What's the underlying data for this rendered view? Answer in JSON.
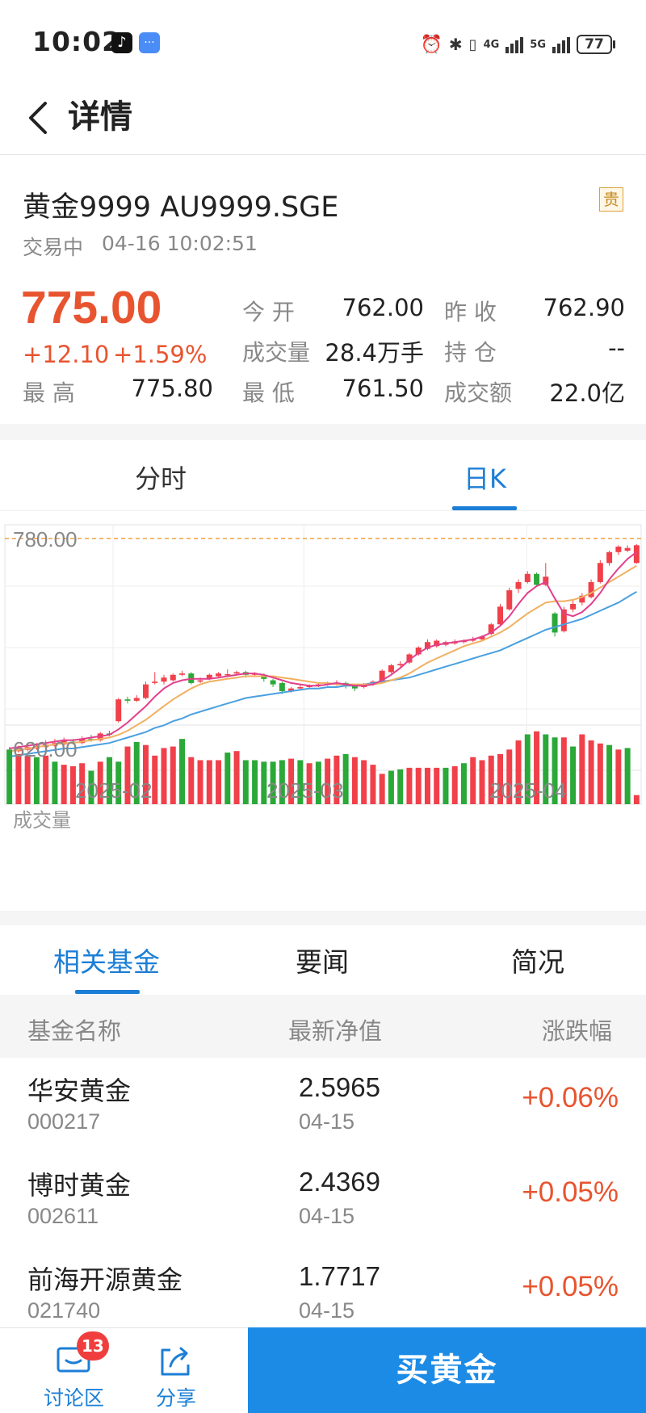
{
  "status_bar": {
    "time": "10:02",
    "network_4g": "4G",
    "network_5g": "5G",
    "battery": "77"
  },
  "nav": {
    "title": "详情"
  },
  "quote": {
    "name": "黄金9999 AU9999.SGE",
    "badge": "贵",
    "status": "交易中",
    "timestamp": "04-16 10:02:51",
    "price": "775.00",
    "change_abs": "+12.10",
    "change_pct": "+1.59%",
    "fields": {
      "open_label": "今  开",
      "open_value": "762.00",
      "prev_close_label": "昨  收",
      "prev_close_value": "762.90",
      "volume_label": "成交量",
      "volume_value": "28.4万手",
      "position_label": "持  仓",
      "position_value": "--",
      "high_label": "最  高",
      "high_value": "775.80",
      "low_label": "最  低",
      "low_value": "761.50",
      "turnover_label": "成交额",
      "turnover_value": "22.0亿"
    }
  },
  "chart_tabs": [
    "分时",
    "日K"
  ],
  "chart_data": {
    "type": "candlestick",
    "title": "",
    "y_labels": [
      "780.00",
      "620.00"
    ],
    "x_labels": [
      "2025-02",
      "2025-03",
      "2025-04"
    ],
    "volume_label": "成交量",
    "ylim": [
      610,
      790
    ],
    "ref_line": 780,
    "colors": {
      "up": "#f0404a",
      "down": "#2aa838",
      "ma5": "#e23f8c",
      "ma10": "#f0b060",
      "ma20": "#4aa0e0",
      "ref": "#f0a040"
    },
    "candles": [
      [
        623.0,
        625.0,
        627.0,
        622.0
      ],
      [
        624.0,
        626.0,
        628.0,
        623.0
      ],
      [
        625.0,
        627.0,
        629.0,
        624.0
      ],
      [
        626.0,
        628.0,
        630.0,
        625.0
      ],
      [
        627.0,
        629.0,
        632.0,
        626.0
      ],
      [
        628.0,
        630.0,
        633.0,
        627.0
      ],
      [
        629.0,
        632.0,
        634.0,
        628.0
      ],
      [
        631.0,
        630.0,
        633.0,
        629.0
      ],
      [
        630.0,
        633.0,
        635.0,
        629.0
      ],
      [
        633.0,
        632.0,
        636.0,
        631.0
      ],
      [
        632.0,
        637.0,
        638.0,
        631.0
      ],
      [
        637.0,
        636.0,
        639.0,
        635.0
      ],
      [
        646.0,
        662.0,
        663.0,
        645.0
      ],
      [
        662.0,
        661.0,
        664.0,
        659.0
      ],
      [
        661.0,
        663.0,
        665.0,
        660.0
      ],
      [
        663.0,
        673.0,
        675.0,
        662.0
      ],
      [
        674.0,
        675.0,
        682.0,
        673.0
      ],
      [
        675.0,
        678.0,
        680.0,
        673.0
      ],
      [
        676.0,
        680.0,
        681.0,
        675.0
      ],
      [
        680.0,
        681.0,
        683.0,
        679.0
      ],
      [
        681.0,
        674.0,
        682.0,
        673.0
      ],
      [
        675.0,
        676.0,
        678.0,
        674.0
      ],
      [
        677.0,
        680.0,
        681.0,
        676.0
      ],
      [
        679.0,
        681.0,
        682.0,
        678.0
      ],
      [
        680.0,
        680.5,
        684.0,
        679.0
      ],
      [
        681.0,
        682.0,
        683.0,
        680.0
      ],
      [
        682.0,
        680.0,
        683.0,
        678.0
      ],
      [
        680.0,
        681.0,
        682.0,
        679.0
      ],
      [
        680.0,
        677.0,
        681.0,
        675.0
      ],
      [
        676.0,
        673.0,
        677.0,
        671.0
      ],
      [
        674.0,
        668.0,
        675.0,
        666.0
      ],
      [
        668.0,
        670.0,
        671.0,
        667.0
      ],
      [
        670.0,
        671.0,
        673.0,
        669.0
      ],
      [
        671.0,
        672.0,
        673.0,
        670.0
      ],
      [
        672.0,
        673.0,
        674.0,
        671.0
      ],
      [
        673.0,
        673.5,
        675.0,
        672.0
      ],
      [
        673.0,
        674.0,
        676.0,
        672.0
      ],
      [
        674.0,
        672.0,
        675.0,
        670.0
      ],
      [
        672.0,
        670.0,
        673.0,
        668.0
      ],
      [
        671.0,
        673.0,
        674.0,
        670.0
      ],
      [
        673.0,
        675.0,
        676.0,
        672.0
      ],
      [
        675.0,
        683.0,
        684.0,
        674.0
      ],
      [
        682.0,
        687.0,
        688.0,
        681.0
      ],
      [
        687.0,
        688.0,
        690.0,
        686.0
      ],
      [
        689.0,
        695.0,
        696.0,
        688.0
      ],
      [
        695.0,
        700.0,
        701.0,
        694.0
      ],
      [
        699.0,
        704.0,
        706.0,
        698.0
      ],
      [
        701.0,
        705.0,
        706.0,
        700.0
      ],
      [
        702.0,
        704.0,
        705.0,
        701.0
      ],
      [
        703.0,
        704.5,
        706.0,
        702.0
      ],
      [
        704.0,
        705.0,
        706.0,
        703.0
      ],
      [
        705.0,
        706.0,
        708.0,
        704.0
      ],
      [
        706.0,
        708.0,
        709.0,
        705.0
      ],
      [
        710.0,
        717.0,
        718.0,
        709.0
      ],
      [
        717.0,
        730.0,
        732.0,
        716.0
      ],
      [
        728.0,
        742.0,
        744.0,
        727.0
      ],
      [
        743.0,
        748.0,
        750.0,
        740.0
      ],
      [
        748.0,
        754.0,
        756.0,
        747.0
      ],
      [
        754.0,
        746.0,
        755.0,
        745.0
      ],
      [
        746.0,
        752.0,
        762.0,
        745.0
      ],
      [
        725.0,
        711.0,
        726.0,
        708.0
      ],
      [
        712.0,
        728.0,
        730.0,
        711.0
      ],
      [
        728.0,
        732.0,
        735.0,
        726.0
      ],
      [
        733.0,
        738.0,
        740.0,
        731.0
      ],
      [
        737.0,
        748.0,
        750.0,
        736.0
      ],
      [
        748.0,
        762.0,
        764.0,
        747.0
      ],
      [
        762.0,
        770.0,
        771.0,
        760.0
      ],
      [
        770.0,
        774.0,
        775.0,
        768.0
      ],
      [
        771.0,
        773.0,
        775.0,
        770.0
      ],
      [
        762.0,
        775.0,
        775.8,
        761.5
      ]
    ],
    "ma5": [
      626,
      627,
      628,
      629,
      630,
      631,
      632,
      632,
      633,
      634,
      635,
      636,
      640,
      645,
      651,
      657,
      664,
      670,
      674,
      676,
      677,
      677,
      677,
      678,
      679,
      680,
      681,
      681,
      680,
      678,
      676,
      674,
      673,
      672,
      672,
      673,
      674,
      673,
      672,
      672,
      673,
      676,
      680,
      685,
      691,
      696,
      700,
      702,
      703,
      704,
      705,
      706,
      708,
      711,
      716,
      723,
      732,
      740,
      745,
      748,
      736,
      725,
      723,
      726,
      732,
      740,
      750,
      758,
      765,
      770
    ],
    "ma10": [
      624,
      625,
      626,
      627,
      628,
      629,
      630,
      630,
      631,
      632,
      633,
      634,
      636,
      639,
      643,
      647,
      652,
      657,
      662,
      666,
      670,
      673,
      675,
      676,
      677,
      678,
      679,
      679,
      679,
      679,
      678,
      677,
      676,
      675,
      674,
      674,
      673,
      673,
      673,
      673,
      673,
      674,
      676,
      678,
      681,
      685,
      689,
      692,
      695,
      698,
      701,
      703,
      705,
      708,
      711,
      715,
      720,
      725,
      729,
      733,
      734,
      734,
      735,
      737,
      740,
      744,
      748,
      752,
      756,
      760
    ],
    "ma20": [
      620,
      621,
      622,
      623,
      624,
      625,
      626,
      626,
      627,
      628,
      629,
      630,
      632,
      634,
      636,
      638,
      641,
      643,
      646,
      648,
      651,
      653,
      655,
      657,
      659,
      661,
      663,
      664,
      665,
      666,
      667,
      668,
      669,
      670,
      670,
      671,
      671,
      672,
      672,
      673,
      674,
      675,
      676,
      677,
      678,
      680,
      682,
      684,
      686,
      688,
      690,
      692,
      694,
      696,
      698,
      701,
      704,
      707,
      710,
      713,
      715,
      717,
      719,
      721,
      724,
      727,
      730,
      733,
      737,
      741
    ],
    "volumes": [
      0.72,
      0.66,
      0.64,
      0.62,
      0.64,
      0.56,
      0.52,
      0.5,
      0.54,
      0.44,
      0.56,
      0.62,
      0.56,
      0.76,
      0.82,
      0.78,
      0.64,
      0.74,
      0.76,
      0.86,
      0.62,
      0.58,
      0.58,
      0.58,
      0.68,
      0.7,
      0.58,
      0.58,
      0.56,
      0.56,
      0.58,
      0.6,
      0.58,
      0.54,
      0.56,
      0.6,
      0.64,
      0.66,
      0.62,
      0.58,
      0.52,
      0.4,
      0.44,
      0.46,
      0.48,
      0.48,
      0.48,
      0.48,
      0.48,
      0.5,
      0.54,
      0.62,
      0.58,
      0.64,
      0.66,
      0.72,
      0.84,
      0.92,
      0.96,
      0.92,
      0.88,
      0.88,
      0.76,
      0.92,
      0.84,
      0.8,
      0.78,
      0.72,
      0.74,
      0.12
    ],
    "volume_dirs": [
      "d",
      "u",
      "u",
      "d",
      "u",
      "d",
      "u",
      "u",
      "u",
      "d",
      "u",
      "d",
      "d",
      "u",
      "d",
      "u",
      "u",
      "u",
      "u",
      "d",
      "u",
      "u",
      "u",
      "u",
      "d",
      "u",
      "d",
      "d",
      "d",
      "d",
      "d",
      "u",
      "d",
      "u",
      "d",
      "u",
      "u",
      "d",
      "u",
      "u",
      "u",
      "u",
      "d",
      "d",
      "u",
      "u",
      "u",
      "u",
      "d",
      "u",
      "d",
      "u",
      "u",
      "u",
      "u",
      "u",
      "u",
      "d",
      "u",
      "d",
      "d",
      "u",
      "d",
      "u",
      "u",
      "u",
      "d",
      "u",
      "d",
      "u"
    ]
  },
  "info_tabs": [
    "相关基金",
    "要闻",
    "简况"
  ],
  "fund_table": {
    "headers": [
      "基金名称",
      "最新净值",
      "涨跌幅"
    ],
    "rows": [
      {
        "name": "华安黄金",
        "code": "000217",
        "nav": "2.5965",
        "date": "04-15",
        "change": "+0.06%"
      },
      {
        "name": "博时黄金",
        "code": "002611",
        "nav": "2.4369",
        "date": "04-15",
        "change": "+0.05%"
      },
      {
        "name": "前海开源黄金",
        "code": "021740",
        "nav": "1.7717",
        "date": "04-15",
        "change": "+0.05%"
      }
    ]
  },
  "bottom_bar": {
    "discuss_label": "讨论区",
    "discuss_badge": "13",
    "share_label": "分享",
    "buy_label": "买黄金"
  }
}
